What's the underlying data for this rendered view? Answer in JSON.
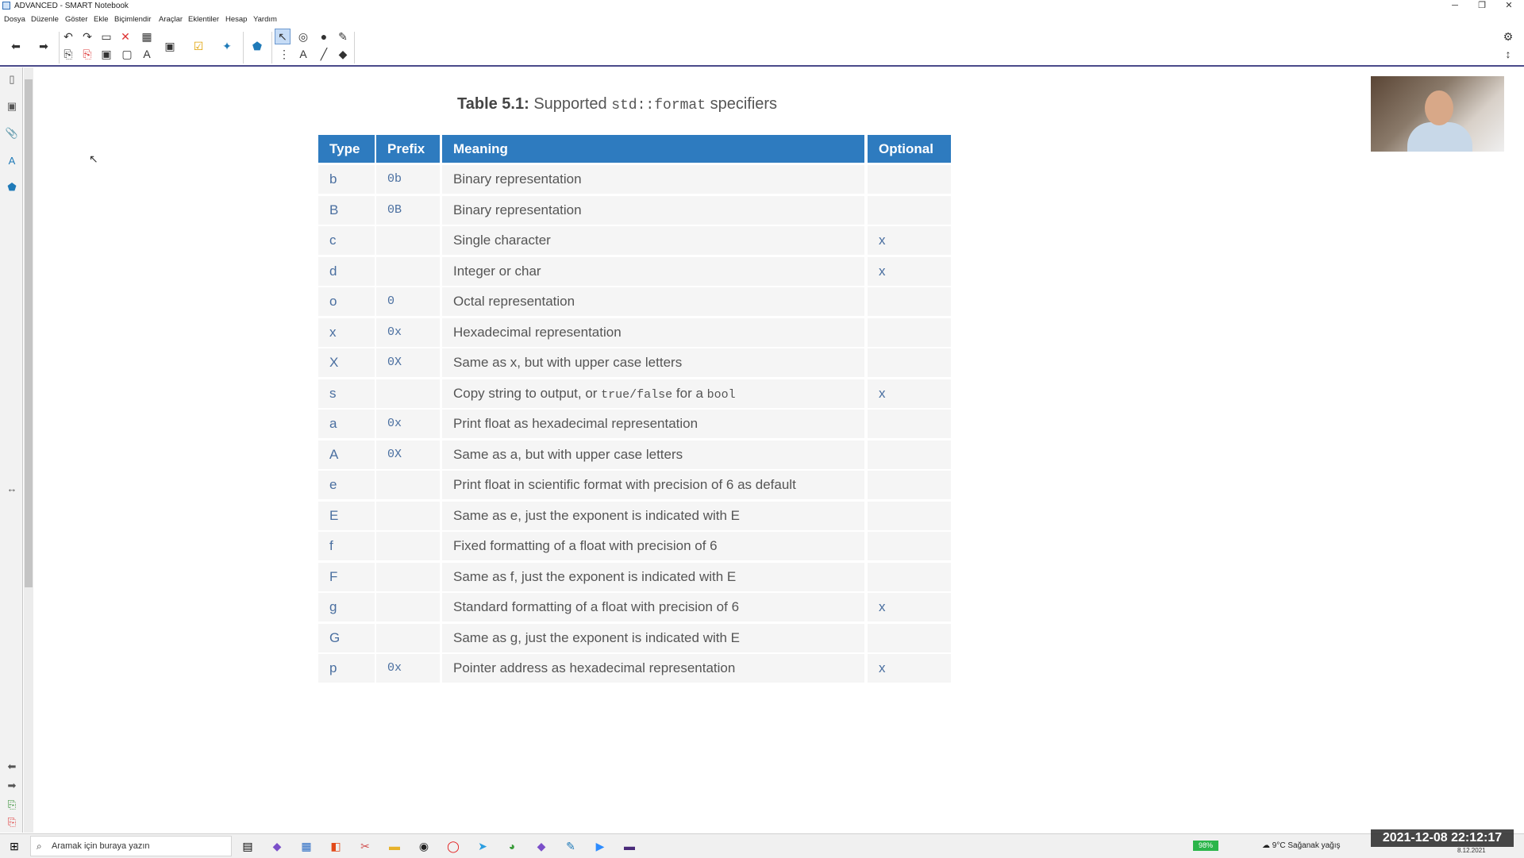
{
  "window": {
    "title": "ADVANCED - SMART Notebook",
    "minimize": "─",
    "restore": "❐",
    "close": "✕"
  },
  "menu": [
    "Dosya",
    "Düzenle",
    "Göster",
    "Ekle",
    "Biçimlendir",
    "Araçlar",
    "Eklentiler",
    "Hesap",
    "Yardım"
  ],
  "table": {
    "title_bold": "Table 5.1:",
    "title_pre": " Supported ",
    "title_code": "std::format",
    "title_post": " specifiers",
    "headers": {
      "type": "Type",
      "prefix": "Prefix",
      "meaning": "Meaning",
      "optional": "Optional"
    },
    "rows": [
      {
        "type": "b",
        "prefix": "0b",
        "meaning": "Binary representation",
        "optional": ""
      },
      {
        "type": "B",
        "prefix": "0B",
        "meaning": "Binary representation",
        "optional": ""
      },
      {
        "type": "c",
        "prefix": "",
        "meaning": "Single character",
        "optional": "x"
      },
      {
        "type": "d",
        "prefix": "",
        "meaning": "Integer or char",
        "optional": "x"
      },
      {
        "type": "o",
        "prefix": "0",
        "meaning": "Octal representation",
        "optional": ""
      },
      {
        "type": "x",
        "prefix": "0x",
        "meaning": "Hexadecimal representation",
        "optional": ""
      },
      {
        "type": "X",
        "prefix": "0X",
        "meaning": "Same as x, but with upper case letters",
        "optional": ""
      },
      {
        "type": "s",
        "prefix": "",
        "meaning_pre": "Copy string to output, or ",
        "meaning_code1": "true/false",
        "meaning_mid": " for a ",
        "meaning_code2": "bool",
        "optional": "x"
      },
      {
        "type": "a",
        "prefix": "0x",
        "meaning": "Print float as hexadecimal representation",
        "optional": ""
      },
      {
        "type": "A",
        "prefix": "0X",
        "meaning": "Same as a, but with upper case letters",
        "optional": ""
      },
      {
        "type": "e",
        "prefix": "",
        "meaning": "Print float in scientific format with precision of 6 as default",
        "optional": ""
      },
      {
        "type": "E",
        "prefix": "",
        "meaning": "Same as e, just the exponent is indicated with E",
        "optional": ""
      },
      {
        "type": "f",
        "prefix": "",
        "meaning": "Fixed formatting of a float with precision of 6",
        "optional": ""
      },
      {
        "type": "F",
        "prefix": "",
        "meaning": "Same as f, just the exponent is indicated with E",
        "optional": ""
      },
      {
        "type": "g",
        "prefix": "",
        "meaning": "Standard formatting of a float with precision of 6",
        "optional": "x"
      },
      {
        "type": "G",
        "prefix": "",
        "meaning": "Same as g, just the exponent is indicated with E",
        "optional": ""
      },
      {
        "type": "p",
        "prefix": "0x",
        "meaning": "Pointer address as hexadecimal representation",
        "optional": "x"
      }
    ]
  },
  "taskbar": {
    "search_placeholder": "Aramak için buraya yazın",
    "battery": "98%",
    "weather": "9°C  Sağanak yağış",
    "date_small": "8.12.2021"
  },
  "overlay_clock": "2021-12-08  22:12:17",
  "colors": {
    "header_bg": "#2e7bbf",
    "row_bg": "#f5f5f5",
    "type_text": "#4a6fa0"
  }
}
